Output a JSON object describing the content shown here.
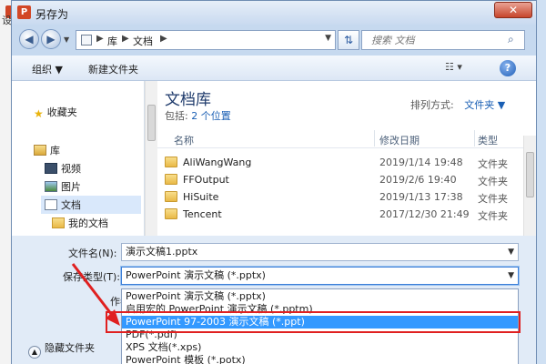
{
  "background": {
    "partial_text": "设"
  },
  "window": {
    "title": "另存为",
    "icon_letter": "P",
    "close": "✕"
  },
  "address": {
    "crumbs": [
      "库",
      "文档"
    ],
    "separator": "▶"
  },
  "search": {
    "placeholder": "搜索 文档"
  },
  "toolbar": {
    "organize": "组织 ▼",
    "new_folder": "新建文件夹",
    "view": "☷ ▾",
    "help": "?"
  },
  "nav": {
    "favorites": "收藏夹",
    "libraries": "库",
    "videos": "视频",
    "pictures": "图片",
    "documents": "文档",
    "my_documents": "我的文档"
  },
  "library": {
    "title": "文档库",
    "includes_label": "包括:",
    "includes_value": "2 个位置",
    "arrange_label": "排列方式:",
    "arrange_value": "文件夹 ▼"
  },
  "columns": {
    "name": "名称",
    "modified": "修改日期",
    "type": "类型"
  },
  "files": [
    {
      "name": "AliWangWang",
      "date": "2019/1/14 19:48",
      "type": "文件夹"
    },
    {
      "name": "FFOutput",
      "date": "2019/2/6 19:40",
      "type": "文件夹"
    },
    {
      "name": "HiSuite",
      "date": "2019/1/13 17:38",
      "type": "文件夹"
    },
    {
      "name": "Tencent",
      "date": "2017/12/30 21:49",
      "type": "文件夹"
    }
  ],
  "form": {
    "filename_label": "文件名(N):",
    "filename_value": "演示文稿1.pptx",
    "savetype_label": "保存类型(T):",
    "savetype_value": "PowerPoint 演示文稿 (*.pptx)",
    "author_label": "作者:",
    "hide_folders": "隐藏文件夹"
  },
  "save_type_options": [
    "PowerPoint 演示文稿 (*.pptx)",
    "启用宏的 PowerPoint 演示文稿 (*.pptm)",
    "PowerPoint 97-2003 演示文稿 (*.ppt)",
    "PDF(*.pdf)",
    "XPS 文档(*.xps)",
    "PowerPoint 模板 (*.potx)"
  ],
  "selected_option_index": 2,
  "colors": {
    "highlight": "#3399ff",
    "annotation": "#e02020"
  }
}
